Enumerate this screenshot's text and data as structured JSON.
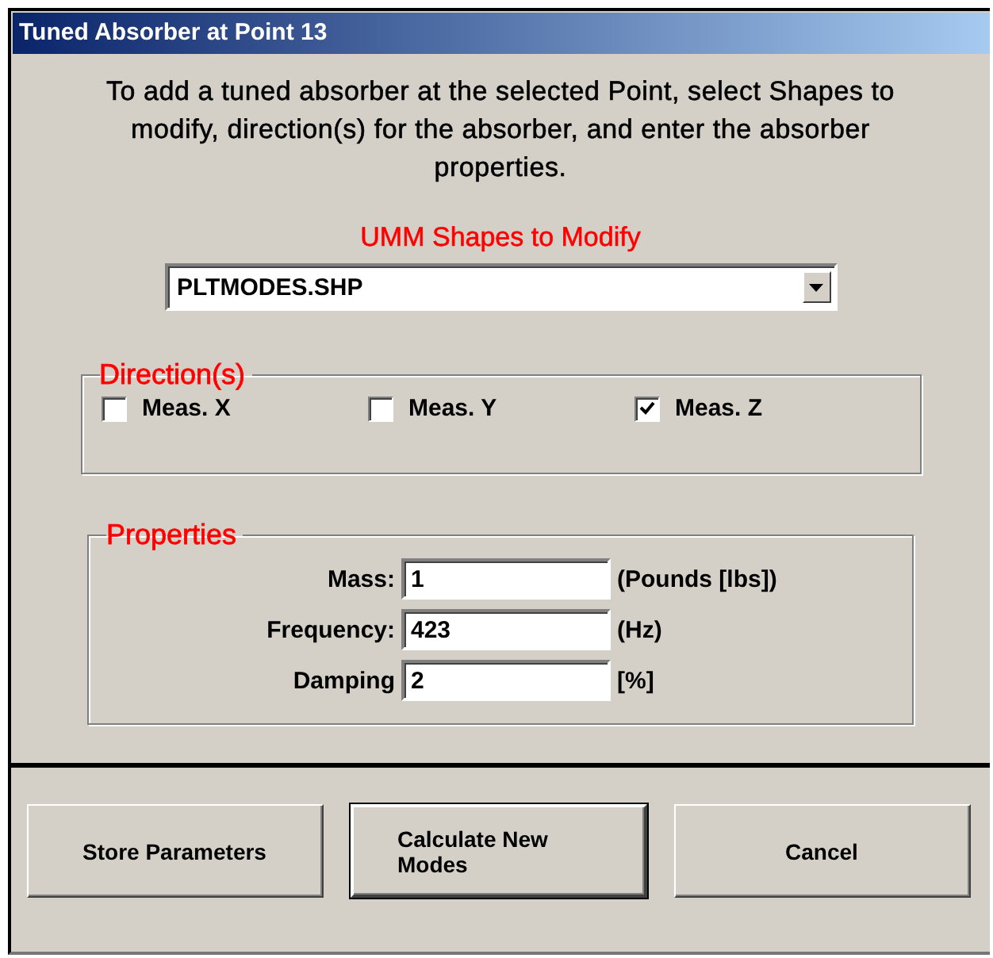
{
  "window": {
    "title": "Tuned Absorber at Point 13"
  },
  "instructions": "To add a tuned absorber at the selected Point, select Shapes to modify, direction(s) for the absorber, and enter the absorber properties.",
  "shapes": {
    "label": "UMM Shapes to Modify",
    "value": "PLTMODES.SHP"
  },
  "directions": {
    "title": "Direction(s)",
    "options": [
      {
        "label": "Meas. X",
        "checked": false
      },
      {
        "label": "Meas. Y",
        "checked": false
      },
      {
        "label": "Meas. Z",
        "checked": true
      }
    ]
  },
  "properties": {
    "title": "Properties",
    "fields": [
      {
        "label": "Mass:",
        "value": "1",
        "unit": "(Pounds [lbs])"
      },
      {
        "label": "Frequency:",
        "value": "423",
        "unit": "(Hz)"
      },
      {
        "label": "Damping",
        "value": "2",
        "unit": "[%]"
      }
    ]
  },
  "buttons": [
    {
      "label": "Store Parameters",
      "default": false
    },
    {
      "label": "Calculate New Modes",
      "default": true
    },
    {
      "label": "Cancel",
      "default": false
    }
  ]
}
